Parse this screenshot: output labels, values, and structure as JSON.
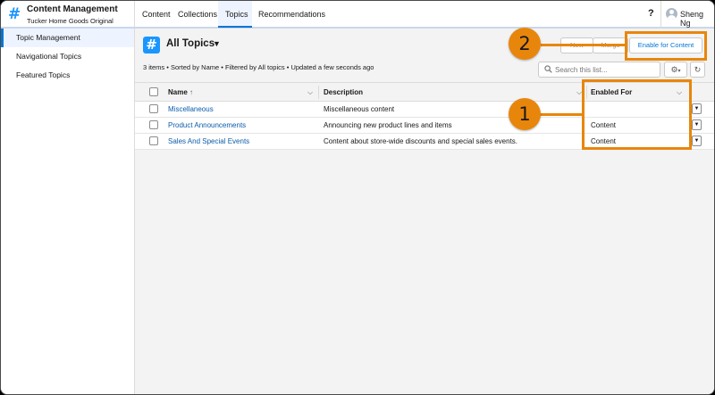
{
  "app": {
    "title": "Content Management",
    "subtitle": "Tucker Home Goods Original",
    "icon": "hash-icon"
  },
  "nav": {
    "tabs": [
      {
        "label": "Content",
        "active": false
      },
      {
        "label": "Collections",
        "active": false
      },
      {
        "label": "Topics",
        "active": true
      },
      {
        "label": "Recommendations",
        "active": false
      }
    ],
    "help_label": "?",
    "user_name": "Sheng Ng"
  },
  "sidebar": {
    "items": [
      {
        "label": "Topic Management",
        "active": true
      },
      {
        "label": "Navigational Topics",
        "active": false
      },
      {
        "label": "Featured Topics",
        "active": false
      }
    ]
  },
  "list": {
    "title": "All Topics",
    "meta": "3 items • Sorted by Name • Filtered by All topics • Updated a few seconds ago",
    "buttons": {
      "new": "New",
      "merge": "Merge",
      "enable_for_content": "Enable for Content"
    },
    "search": {
      "placeholder": "Search this list..."
    }
  },
  "table": {
    "columns": {
      "name": "Name",
      "name_sort": "↑",
      "description": "Description",
      "enabled_for": "Enabled For"
    },
    "rows": [
      {
        "name": "Miscellaneous",
        "description": "Miscellaneous content",
        "enabled_for": ""
      },
      {
        "name": "Product Announcements",
        "description": "Announcing new product lines and items",
        "enabled_for": "Content"
      },
      {
        "name": "Sales And Special Events",
        "description": "Content about store-wide discounts and special sales events.",
        "enabled_for": "Content"
      }
    ]
  },
  "callouts": {
    "one": "1",
    "two": "2",
    "color": "#e8860c"
  },
  "colors": {
    "brand_blue": "#0176d3",
    "link_blue": "#0b5cab",
    "icon_blue": "#1b96ff"
  }
}
